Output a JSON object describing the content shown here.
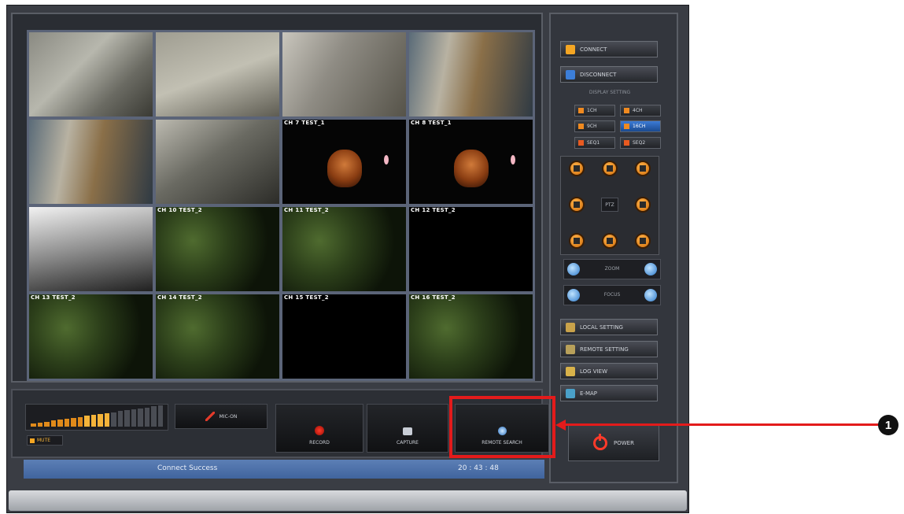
{
  "cameras": [
    {
      "label": "",
      "scene": "office",
      "selected": true
    },
    {
      "label": "",
      "scene": "office2"
    },
    {
      "label": "",
      "scene": "counter"
    },
    {
      "label": "",
      "scene": "hall"
    },
    {
      "label": "",
      "scene": "hall"
    },
    {
      "label": "",
      "scene": "desk"
    },
    {
      "label": "CH 7 TEST_1",
      "scene": "bear"
    },
    {
      "label": "CH 8 TEST_1",
      "scene": "bear"
    },
    {
      "label": "",
      "scene": "bw"
    },
    {
      "label": "CH 10 TEST_2",
      "scene": "leaf"
    },
    {
      "label": "CH 11 TEST_2",
      "scene": "leaf"
    },
    {
      "label": "CH 12 TEST_2",
      "scene": "black"
    },
    {
      "label": "CH 13 TEST_2",
      "scene": "leaf"
    },
    {
      "label": "CH 14 TEST_2",
      "scene": "leaf"
    },
    {
      "label": "CH 15 TEST_2",
      "scene": "black"
    },
    {
      "label": "CH 16 TEST_2",
      "scene": "leaf"
    }
  ],
  "side": {
    "connect": "CONNECT",
    "disconnect": "DISCONNECT",
    "display_title": "DISPLAY SETTING",
    "split": [
      "1CH",
      "4CH",
      "9CH",
      "16CH",
      "SEQ1",
      "SEQ2"
    ],
    "ptz_label": "PTZ",
    "zoom_label": "ZOOM",
    "focus_label": "FOCUS",
    "local_setting": "LOCAL SETTING",
    "remote_setting": "REMOTE SETTING",
    "log_view": "LOG VIEW",
    "emap": "E-MAP",
    "power": "POWER"
  },
  "bottom": {
    "mute": "MUTE",
    "mic": "MIC-ON",
    "record": "RECORD",
    "capture": "CAPTURE",
    "remote_search": "REMOTE SEARCH",
    "volume_level": 0.6
  },
  "status": {
    "text": "Connect Success",
    "time": "20 : 43 : 48"
  },
  "callout_number": "1"
}
